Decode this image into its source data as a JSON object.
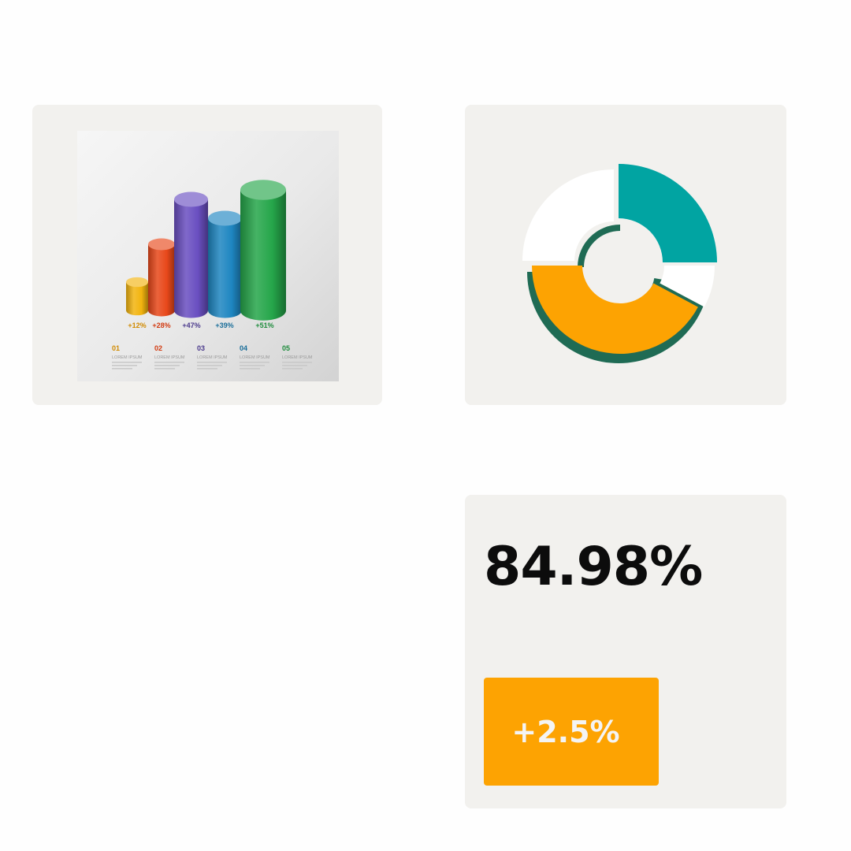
{
  "bar_infographic": {
    "chart_data": {
      "type": "bar",
      "categories": [
        "01",
        "02",
        "03",
        "04",
        "05"
      ],
      "values": [
        12,
        28,
        47,
        39,
        51
      ],
      "value_labels": [
        "+12%",
        "+28%",
        "+47%",
        "+39%",
        "+51%"
      ],
      "item_numbers": [
        "01",
        "02",
        "03",
        "04",
        "05"
      ],
      "item_captions": [
        "LOREM IPSUM",
        "LOREM IPSUM",
        "LOREM IPSUM",
        "LOREM IPSUM",
        "LOREM IPSUM"
      ],
      "colors": [
        "#f2b40f",
        "#e8481a",
        "#6a4fc1",
        "#1e86c1",
        "#25a64a"
      ],
      "label_colors": [
        "#d08a00",
        "#d23a10",
        "#4b3a8c",
        "#1a6e9a",
        "#1e8c3c"
      ],
      "ylim": [
        0,
        60
      ],
      "title": "",
      "xlabel": "",
      "ylabel": ""
    }
  },
  "donut_chart": {
    "chart_data": {
      "type": "pie",
      "segments": [
        {
          "start_deg": 0,
          "end_deg": 90,
          "color": "#01a4a2"
        },
        {
          "start_deg": 90,
          "end_deg": 118,
          "color": "#ffffff"
        },
        {
          "start_deg": 118,
          "end_deg": 270,
          "color": "#fda302"
        },
        {
          "start_deg": 270,
          "end_deg": 360,
          "color": "#ffffff"
        }
      ],
      "shadow_color": "#1f6b54"
    }
  },
  "stat_card": {
    "value": "84.98%",
    "change": "+2.5%",
    "accent_color": "#fda302"
  }
}
